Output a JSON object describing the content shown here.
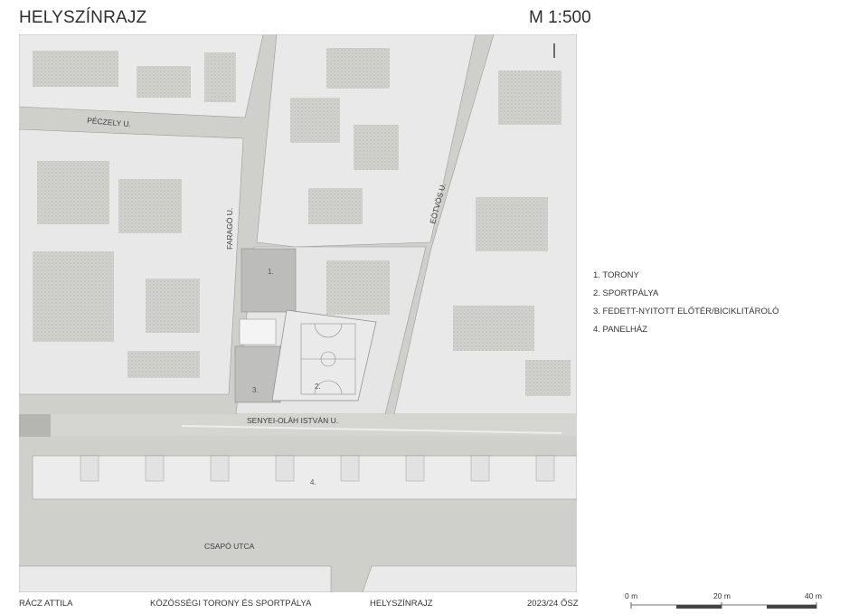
{
  "header": {
    "title": "HELYSZÍNRAJZ",
    "scale": "M 1:500"
  },
  "plan": {
    "streets": {
      "peczely": "PÉCZELY U.",
      "farago": "FARAGÓ U.",
      "eotvos": "EÖTVÖS U.",
      "senyei": "SENYEI-OLÁH ISTVÁN U.",
      "csapo": "CSAPÓ UTCA"
    },
    "labels": {
      "n1": "1.",
      "n2": "2.",
      "n3": "3.",
      "n4": "4."
    }
  },
  "legend": [
    "1. TORONY",
    "2. SPORTPÁLYA",
    "3. FEDETT-NYITOTT ELŐTÉR/BICIKLITÁROLÓ",
    "4. PANELHÁZ"
  ],
  "footer": {
    "author": "RÁCZ ATTILA",
    "project": "KÖZÖSSÉGI TORONY ÉS SPORTPÁLYA",
    "sheet": "HELYSZÍNRAJZ",
    "semester": "2023/24 ŐSZ"
  },
  "scalebar": {
    "l0": "0 m",
    "l20": "20 m",
    "l40": "40 m"
  }
}
